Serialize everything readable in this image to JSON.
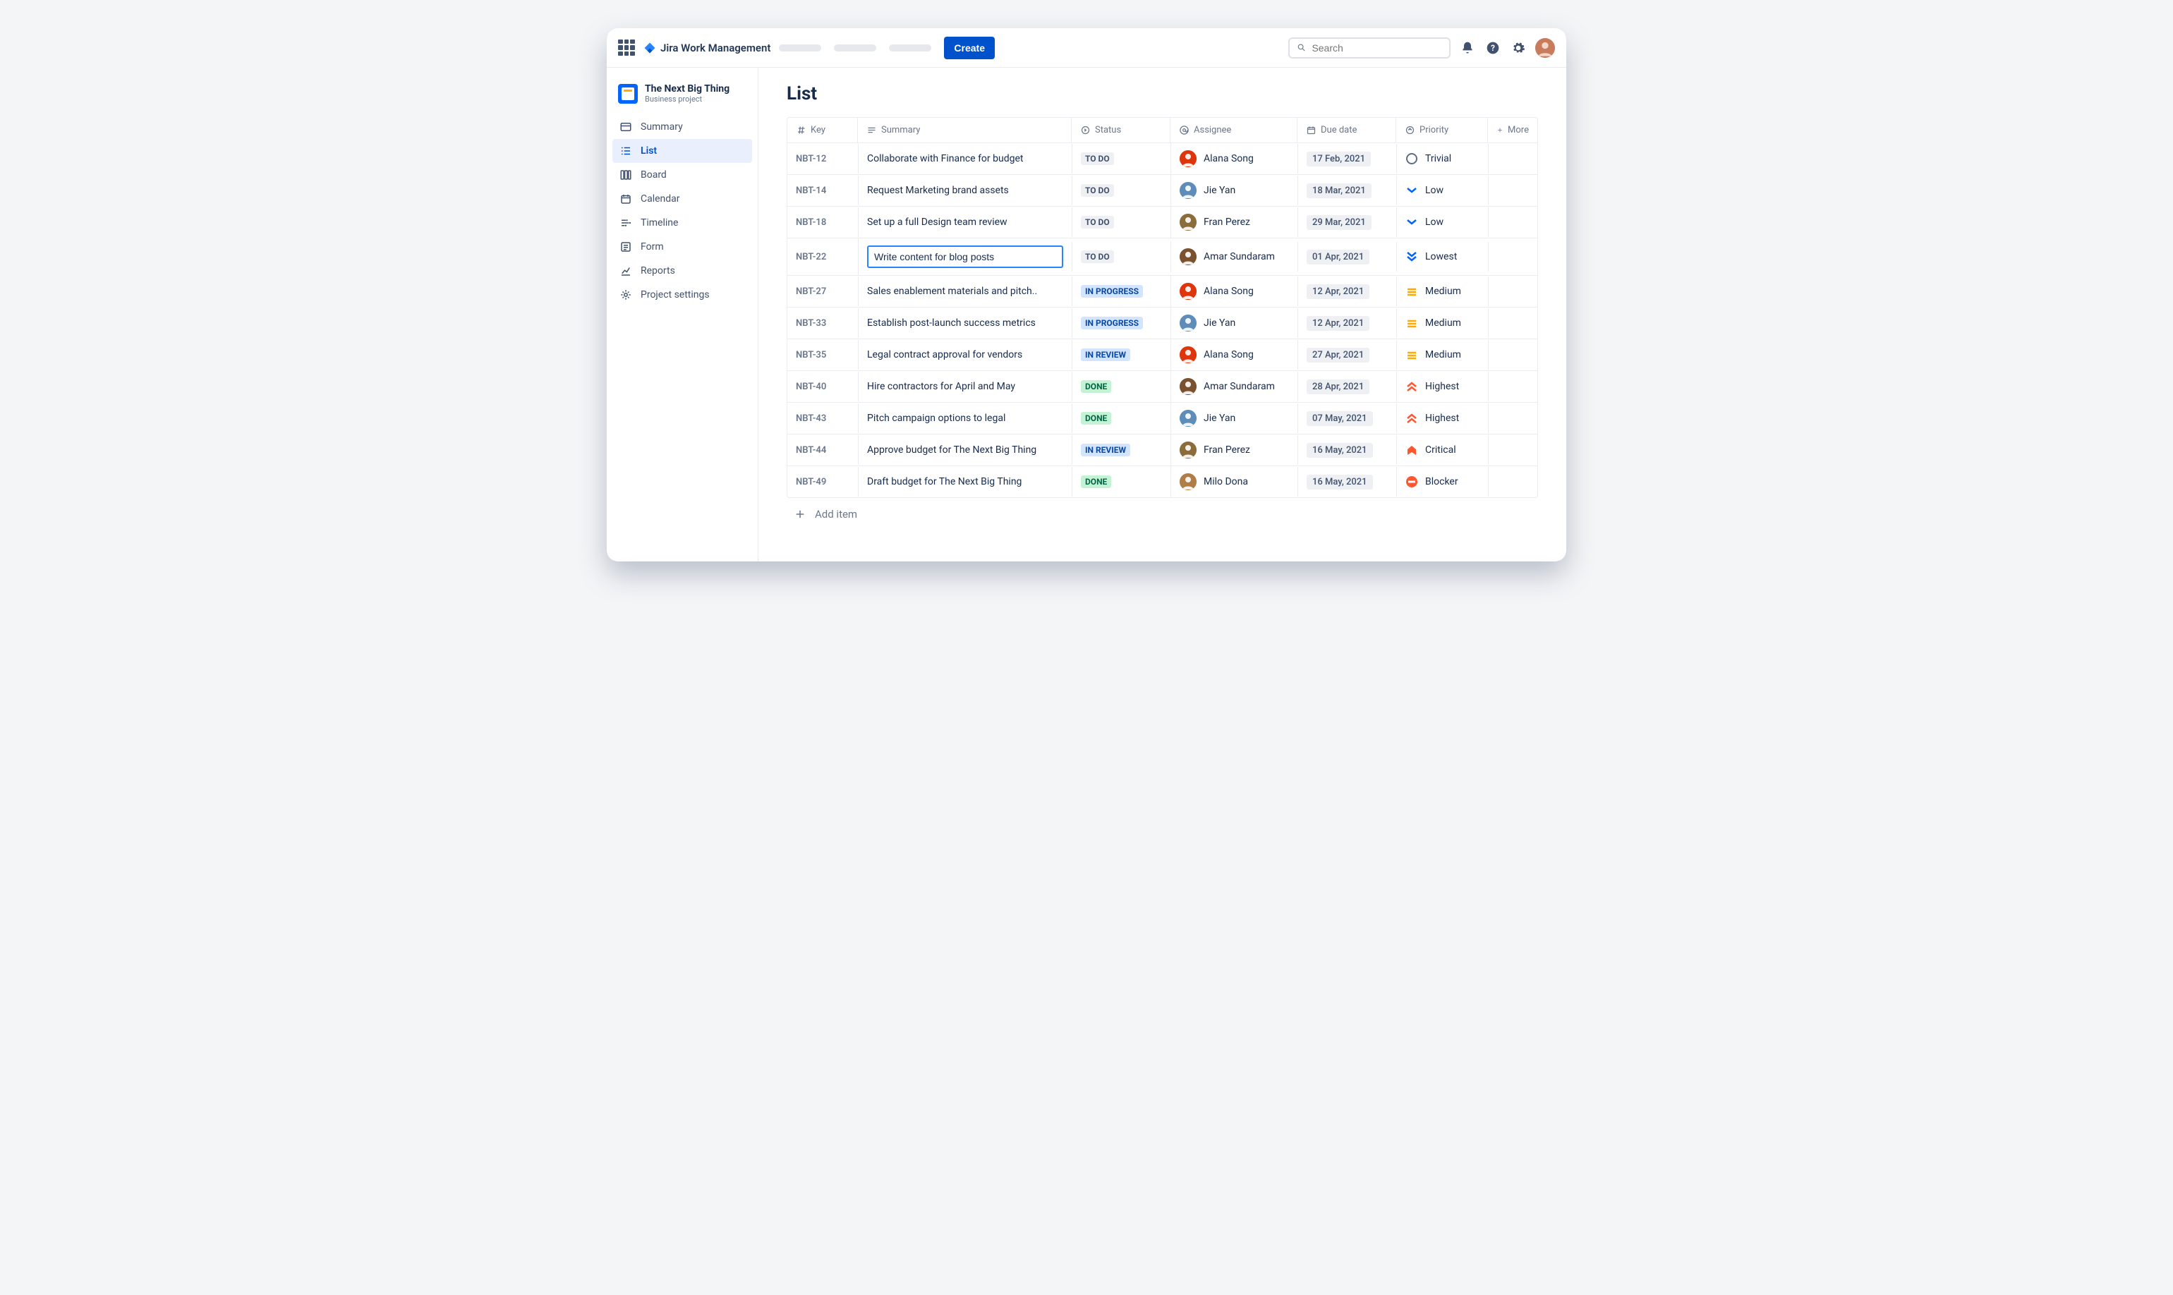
{
  "brand": "Jira Work Management",
  "create_label": "Create",
  "search_placeholder": "Search",
  "project": {
    "name": "The Next Big Thing",
    "type": "Business project"
  },
  "sidebar": [
    {
      "key": "summary",
      "label": "Summary"
    },
    {
      "key": "list",
      "label": "List"
    },
    {
      "key": "board",
      "label": "Board"
    },
    {
      "key": "calendar",
      "label": "Calendar"
    },
    {
      "key": "timeline",
      "label": "Timeline"
    },
    {
      "key": "form",
      "label": "Form"
    },
    {
      "key": "reports",
      "label": "Reports"
    },
    {
      "key": "settings",
      "label": "Project settings"
    }
  ],
  "sidebar_active": "list",
  "page_title": "List",
  "columns": {
    "key": "Key",
    "summary": "Summary",
    "status": "Status",
    "assignee": "Assignee",
    "due": "Due date",
    "priority": "Priority",
    "more": "More"
  },
  "add_item_label": "Add item",
  "editing_key": "NBT-22",
  "status_styles": {
    "TO DO": "status-todo",
    "IN PROGRESS": "status-inprogress",
    "IN REVIEW": "status-inreview",
    "DONE": "status-done"
  },
  "avatar_colors": {
    "Alana Song": "#de350b",
    "Jie Yan": "#5e8db9",
    "Fran Perez": "#8a6d3b",
    "Amar Sundaram": "#7a5230",
    "Milo Dona": "#b07d46"
  },
  "rows": [
    {
      "key": "NBT-12",
      "summary": "Collaborate with Finance for budget",
      "status": "TO DO",
      "assignee": "Alana Song",
      "due": "17 Feb, 2021",
      "priority": "Trivial"
    },
    {
      "key": "NBT-14",
      "summary": "Request Marketing brand assets",
      "status": "TO DO",
      "assignee": "Jie Yan",
      "due": "18 Mar, 2021",
      "priority": "Low"
    },
    {
      "key": "NBT-18",
      "summary": "Set up a full Design team review",
      "status": "TO DO",
      "assignee": "Fran Perez",
      "due": "29 Mar, 2021",
      "priority": "Low"
    },
    {
      "key": "NBT-22",
      "summary": "Write content for blog posts",
      "status": "TO DO",
      "assignee": "Amar Sundaram",
      "due": "01 Apr, 2021",
      "priority": "Lowest"
    },
    {
      "key": "NBT-27",
      "summary": "Sales enablement materials and pitch..",
      "status": "IN PROGRESS",
      "assignee": "Alana Song",
      "due": "12 Apr, 2021",
      "priority": "Medium"
    },
    {
      "key": "NBT-33",
      "summary": "Establish post-launch success metrics",
      "status": "IN PROGRESS",
      "assignee": "Jie Yan",
      "due": "12 Apr, 2021",
      "priority": "Medium"
    },
    {
      "key": "NBT-35",
      "summary": "Legal contract approval for vendors",
      "status": "IN REVIEW",
      "assignee": "Alana Song",
      "due": "27 Apr, 2021",
      "priority": "Medium"
    },
    {
      "key": "NBT-40",
      "summary": "Hire contractors for April and May",
      "status": "DONE",
      "assignee": "Amar Sundaram",
      "due": "28 Apr, 2021",
      "priority": "Highest"
    },
    {
      "key": "NBT-43",
      "summary": "Pitch campaign options to legal",
      "status": "DONE",
      "assignee": "Jie Yan",
      "due": "07 May, 2021",
      "priority": "Highest"
    },
    {
      "key": "NBT-44",
      "summary": "Approve budget for The Next Big Thing",
      "status": "IN REVIEW",
      "assignee": "Fran Perez",
      "due": "16 May, 2021",
      "priority": "Critical"
    },
    {
      "key": "NBT-49",
      "summary": "Draft budget for The Next Big Thing",
      "status": "DONE",
      "assignee": "Milo Dona",
      "due": "16 May, 2021",
      "priority": "Blocker"
    }
  ]
}
